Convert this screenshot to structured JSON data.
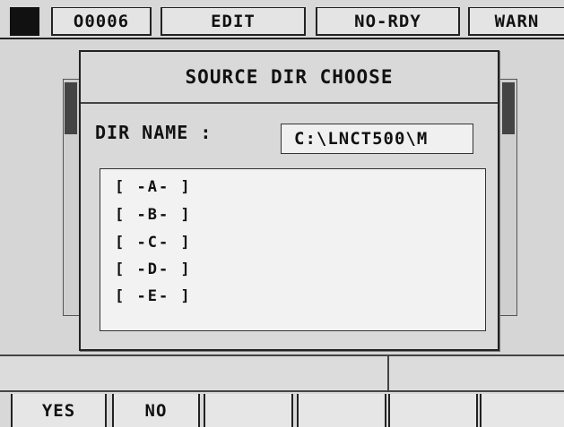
{
  "status_bar": {
    "program": "O0006",
    "mode": "EDIT",
    "ready_state": "NO-RDY",
    "alarm": "WARN"
  },
  "dialog": {
    "title": "SOURCE DIR CHOOSE",
    "dir_label": "DIR NAME :",
    "dir_value": "C:\\LNCT500\\M",
    "items": [
      "[ -A- ]",
      "[ -B- ]",
      "[ -C- ]",
      "[ -D- ]",
      "[ -E- ]"
    ]
  },
  "softkeys": [
    "YES",
    "NO",
    "",
    "",
    "",
    ""
  ]
}
